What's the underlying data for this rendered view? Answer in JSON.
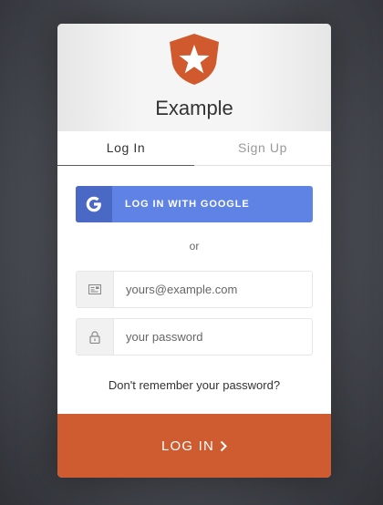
{
  "app": {
    "title": "Example"
  },
  "tabs": [
    {
      "label": "Log In",
      "active": true
    },
    {
      "label": "Sign Up",
      "active": false
    }
  ],
  "social": {
    "google_label": "LOG IN WITH GOOGLE",
    "google_icon": "google-g-icon",
    "google_color": "#5f83e4"
  },
  "separator": {
    "text": "or"
  },
  "form": {
    "email": {
      "value": "",
      "placeholder": "yours@example.com",
      "icon": "envelope-icon"
    },
    "password": {
      "value": "",
      "placeholder": "your password",
      "icon": "lock-icon"
    },
    "forgot_label": "Don't remember your password?"
  },
  "submit": {
    "label": "LOG IN",
    "icon": "chevron-right-icon",
    "color": "#cf5c31"
  },
  "logo": {
    "icon": "shield-star-icon",
    "color": "#d0592e"
  }
}
